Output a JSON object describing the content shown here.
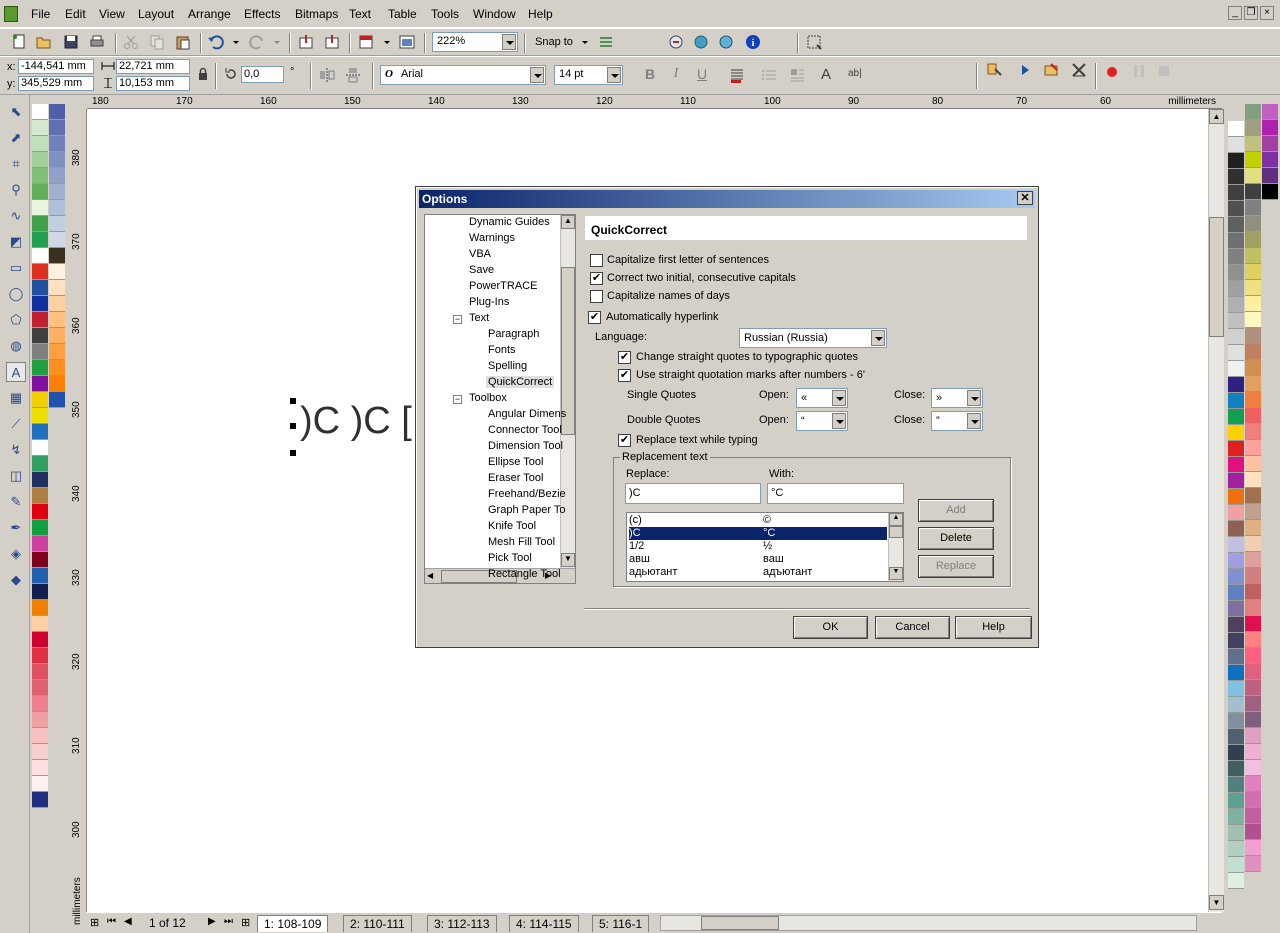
{
  "menu": [
    "File",
    "Edit",
    "View",
    "Layout",
    "Arrange",
    "Effects",
    "Bitmaps",
    "Text",
    "Table",
    "Tools",
    "Window",
    "Help"
  ],
  "toolbar": {
    "zoom": "222%",
    "snap_to": "Snap to"
  },
  "props": {
    "x": "-144,541 mm",
    "y": "345,529 mm",
    "w": "22,721 mm",
    "h": "10,153 mm",
    "angle": "0,0",
    "angle_unit": "°",
    "font": "Arial",
    "size": "14 pt"
  },
  "ruler": {
    "h_ticks": [
      "180",
      "170",
      "160",
      "150",
      "140",
      "130",
      "120",
      "110",
      "100",
      "90",
      "80",
      "70",
      "60"
    ],
    "v_ticks": [
      "380",
      "370",
      "360",
      "350",
      "340",
      "330",
      "320",
      "310",
      "300"
    ],
    "units": "millimeters"
  },
  "canvas_text": ")C )C [",
  "status": {
    "page_counter": "1 of 12",
    "tabs": [
      "1: 108-109",
      "2: 110-111",
      "3: 112-113",
      "4: 114-115",
      "5: 116-1"
    ]
  },
  "dialog": {
    "title": "Options",
    "tree": [
      {
        "label": "Dynamic Guides",
        "level": 1
      },
      {
        "label": "Warnings",
        "level": 1
      },
      {
        "label": "VBA",
        "level": 1
      },
      {
        "label": "Save",
        "level": 1
      },
      {
        "label": "PowerTRACE",
        "level": 1
      },
      {
        "label": "Plug-Ins",
        "level": 1
      },
      {
        "label": "Text",
        "level": 1,
        "exp": "−"
      },
      {
        "label": "Paragraph",
        "level": 2
      },
      {
        "label": "Fonts",
        "level": 2
      },
      {
        "label": "Spelling",
        "level": 2
      },
      {
        "label": "QuickCorrect",
        "level": 2,
        "selected": true
      },
      {
        "label": "Toolbox",
        "level": 1,
        "exp": "−"
      },
      {
        "label": "Angular Dimens",
        "level": 2
      },
      {
        "label": "Connector Tool",
        "level": 2
      },
      {
        "label": "Dimension Tool",
        "level": 2
      },
      {
        "label": "Ellipse Tool",
        "level": 2
      },
      {
        "label": "Eraser Tool",
        "level": 2
      },
      {
        "label": "Freehand/Bezie",
        "level": 2
      },
      {
        "label": "Graph Paper To",
        "level": 2
      },
      {
        "label": "Knife Tool",
        "level": 2
      },
      {
        "label": "Mesh Fill Tool",
        "level": 2
      },
      {
        "label": "Pick Tool",
        "level": 2
      },
      {
        "label": "Rectangle Tool",
        "level": 2
      }
    ],
    "panel_title": "QuickCorrect",
    "checks": [
      {
        "label": "Capitalize first letter of sentences",
        "checked": false
      },
      {
        "label": "Correct two initial, consecutive capitals",
        "checked": true
      },
      {
        "label": "Capitalize names of days",
        "checked": false
      },
      {
        "label": "Automatically hyperlink",
        "checked": true
      }
    ],
    "language_label": "Language:",
    "language": "Russian (Russia)",
    "quote_checks": [
      {
        "label": "Change straight quotes to typographic quotes",
        "checked": true
      },
      {
        "label": "Use straight quotation marks after numbers - 6'",
        "checked": true
      }
    ],
    "single_quotes": {
      "label": "Single Quotes",
      "open_label": "Open:",
      "open": "«",
      "close_label": "Close:",
      "close": "»"
    },
    "double_quotes": {
      "label": "Double Quotes",
      "open_label": "Open:",
      "open": "“",
      "close_label": "Close:",
      "close": "”"
    },
    "replace_check": {
      "label": "Replace text while typing",
      "checked": true
    },
    "group_label": "Replacement text",
    "replace_label": "Replace:",
    "with_label": "With:",
    "replace_value": ")C",
    "with_value": "°C",
    "entries": [
      {
        "from": "(c)",
        "to": "©"
      },
      {
        "from": ")C",
        "to": "°C",
        "selected": true
      },
      {
        "from": "1/2",
        "to": "½"
      },
      {
        "from": "авш",
        "to": "ваш"
      },
      {
        "from": "адьютант",
        "to": "адъютант"
      }
    ],
    "buttons": {
      "add": "Add",
      "delete": "Delete",
      "replace": "Replace",
      "ok": "OK",
      "cancel": "Cancel",
      "help": "Help"
    }
  },
  "palette_left_col1": [
    "#ffffff",
    "#d4e8d0",
    "#bfe0b8",
    "#a0d098",
    "#80c078",
    "#60b058",
    "#e8f4e0",
    "#40a048",
    "#20a050",
    "#ffffff",
    "#e03020",
    "#2050a0",
    "#1030a0",
    "#c02030",
    "#404040",
    "#808080",
    "#20a040",
    "#8010a0",
    "#f0d000",
    "#f0e000",
    "#2070c0",
    "#ffffff",
    "#30a060",
    "#203060",
    "#b08040",
    "#e00010",
    "#10a040",
    "#d040a0",
    "#800020",
    "#2060b0",
    "#102050",
    "#f08000",
    "#ffd0a0",
    "#d00030",
    "#e03040",
    "#e05060",
    "#e06070",
    "#f08090",
    "#f0a0a0",
    "#f8c0c0",
    "#f8d0d0",
    "#ffe0e0",
    "#fff0f0",
    "#203080"
  ],
  "palette_left_col2": [
    "#5060a8",
    "#6070b0",
    "#7080b8",
    "#8090c0",
    "#90a0c8",
    "#a0b0d0",
    "#b0c0d8",
    "#c0d0e0",
    "#d0d8e8",
    "#3a3020",
    "#fff0e0",
    "#ffe0c0",
    "#ffd0a0",
    "#ffc080",
    "#ffb060",
    "#ffa040",
    "#ff9020",
    "#ff8000",
    "#2050b0"
  ],
  "palette_right_col1": [
    "#ffffff",
    "#e0e0e0",
    "#202020",
    "#303030",
    "#404040",
    "#505050",
    "#606060",
    "#707070",
    "#808080",
    "#909090",
    "#a0a0a0",
    "#b0b0b0",
    "#c0c0c0",
    "#d0d0d0",
    "#e0e0e0",
    "#f0f0f0",
    "#302080",
    "#1080c0",
    "#10a050",
    "#ffd000",
    "#e02020",
    "#e01080",
    "#a020a0",
    "#f07010",
    "#f0a0a0",
    "#906050",
    "#c0c0e0",
    "#a0a0e0",
    "#8090d0",
    "#6080c0",
    "#8070a0",
    "#504060",
    "#404060",
    "#607090",
    "#1070c0",
    "#80c0e0",
    "#a0c0d0",
    "#8090a0",
    "#506070",
    "#304050",
    "#406060",
    "#508080",
    "#60a090",
    "#80b0a0",
    "#a0c0b0",
    "#b0d0c0",
    "#c0e0d0",
    "#e0f0e0"
  ],
  "palette_right_col2": [
    "#80a080",
    "#a0a080",
    "#c0c080",
    "#c0d000",
    "#e0e080",
    "#404040",
    "#808080",
    "#909080",
    "#a0a060",
    "#c0c060",
    "#e0d060",
    "#f0e080",
    "#fff0a0",
    "#fff8c0",
    "#b09080",
    "#c08060",
    "#d09050",
    "#e0a060",
    "#f08040",
    "#f06060",
    "#f08080",
    "#ffa0a0",
    "#ffc0a0",
    "#ffe0c0",
    "#a07050",
    "#c0a090",
    "#e0b080",
    "#f0d0b0",
    "#e0a0a0",
    "#d08080",
    "#c06060",
    "#e08080",
    "#e01050",
    "#ff8080",
    "#ff6080",
    "#e06080",
    "#c06080",
    "#a06080",
    "#806080",
    "#e0a0c0",
    "#f0b0d0",
    "#f0c0e0",
    "#e080c0",
    "#d070b0",
    "#c060a0",
    "#b05090",
    "#f0a0d0",
    "#e090c0"
  ],
  "palette_right_col3": [
    "#c060c0",
    "#b020b0",
    "#a040a0",
    "#8030a0",
    "#603080",
    "#000000"
  ]
}
